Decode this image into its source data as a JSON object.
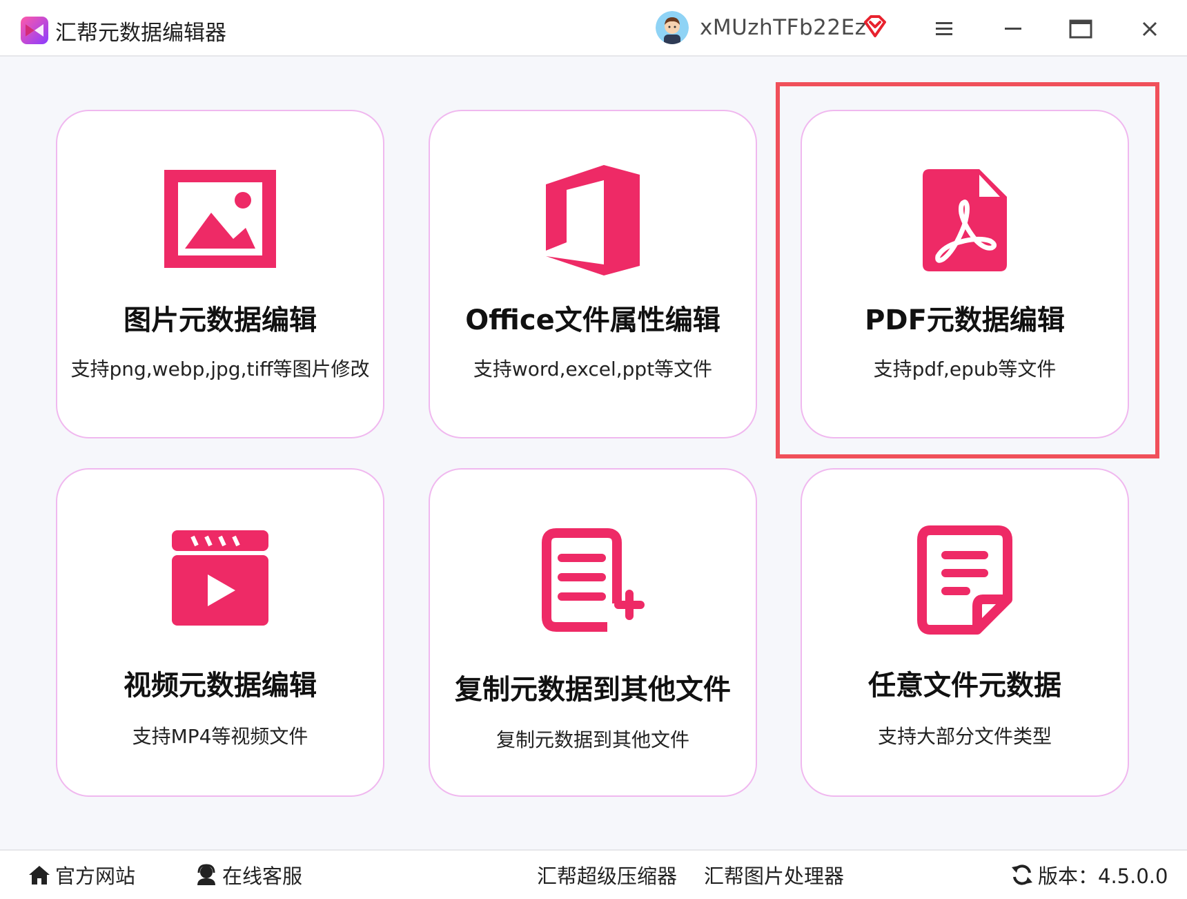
{
  "app": {
    "title": "汇帮元数据编辑器",
    "username": "xMUzhTFb22Ez"
  },
  "colors": {
    "accent": "#ee2a66",
    "card_border": "#f0b8ef",
    "highlight": "#f0505a"
  },
  "cards": [
    {
      "title": "图片元数据编辑",
      "desc": "支持png,webp,jpg,tiff等图片修改",
      "icon": "image-icon"
    },
    {
      "title": "Office文件属性编辑",
      "desc": "支持word,excel,ppt等文件",
      "icon": "office-icon"
    },
    {
      "title": "PDF元数据编辑",
      "desc": "支持pdf,epub等文件",
      "icon": "pdf-icon"
    },
    {
      "title": "视频元数据编辑",
      "desc": "支持MP4等视频文件",
      "icon": "video-icon"
    },
    {
      "title": "复制元数据到其他文件",
      "desc": "复制元数据到其他文件",
      "icon": "copy-metadata-icon"
    },
    {
      "title": "任意文件元数据",
      "desc": "支持大部分文件类型",
      "icon": "document-icon"
    }
  ],
  "footer": {
    "site": "官方网站",
    "service": "在线客服",
    "compressor": "汇帮超级压缩器",
    "image_tool": "汇帮图片处理器",
    "version": "版本：4.5.0.0"
  }
}
